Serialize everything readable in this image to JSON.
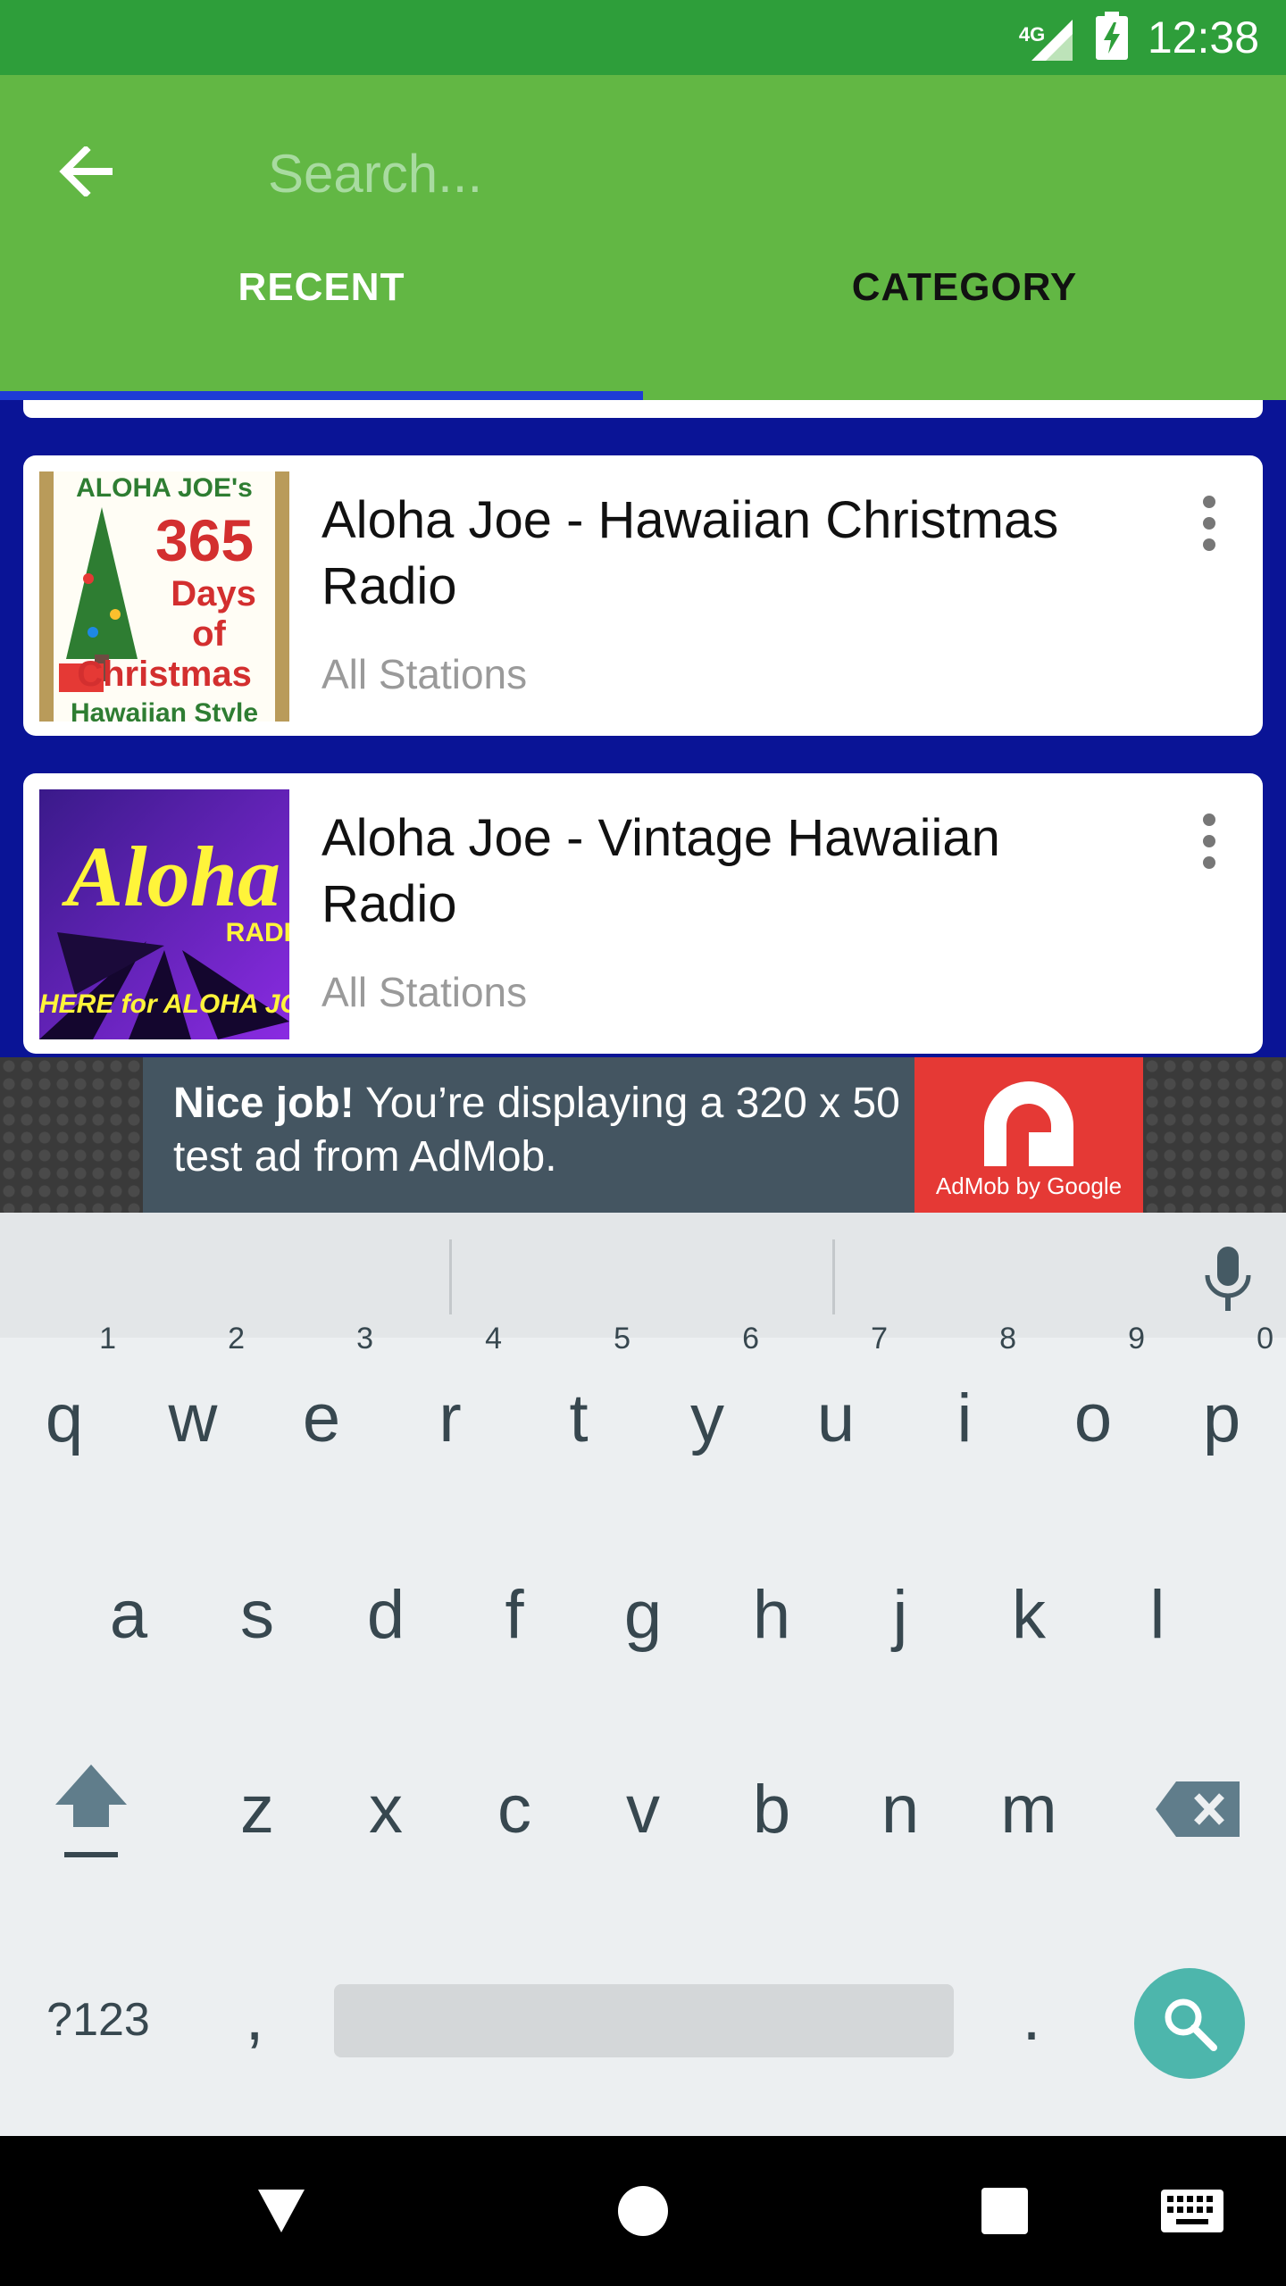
{
  "status_bar": {
    "network": "4G",
    "time": "12:38"
  },
  "toolbar": {
    "search_placeholder": "Search...",
    "tabs": [
      {
        "label": "RECENT",
        "active": true
      },
      {
        "label": "CATEGORY",
        "active": false
      }
    ]
  },
  "stations": [
    {
      "title": "Aloha Joe - Hawaiian Christmas Radio",
      "subtitle": "All Stations",
      "thumb_text": [
        "ALOHA JOE's",
        "365",
        "Days",
        "of",
        "Christmas",
        "Hawaiian Style"
      ]
    },
    {
      "title": "Aloha Joe - Vintage Hawaiian Radio",
      "subtitle": "All Stations",
      "thumb_text": [
        "Aloha",
        "RADI",
        "HERE for ALOHA JOE R"
      ]
    }
  ],
  "ad": {
    "bold": "Nice job!",
    "text": " You’re displaying a 320 x 50 test ad from AdMob.",
    "logo_text": "AdMob by Google"
  },
  "keyboard": {
    "row1": [
      {
        "key": "q",
        "hint": "1"
      },
      {
        "key": "w",
        "hint": "2"
      },
      {
        "key": "e",
        "hint": "3"
      },
      {
        "key": "r",
        "hint": "4"
      },
      {
        "key": "t",
        "hint": "5"
      },
      {
        "key": "y",
        "hint": "6"
      },
      {
        "key": "u",
        "hint": "7"
      },
      {
        "key": "i",
        "hint": "8"
      },
      {
        "key": "o",
        "hint": "9"
      },
      {
        "key": "p",
        "hint": "0"
      }
    ],
    "row2": [
      "a",
      "s",
      "d",
      "f",
      "g",
      "h",
      "j",
      "k",
      "l"
    ],
    "row3": [
      "z",
      "x",
      "c",
      "v",
      "b",
      "n",
      "m"
    ],
    "symbols_label": "?123",
    "comma": ",",
    "period": "."
  },
  "colors": {
    "status_bar": "#2e9e3a",
    "toolbar": "#62b744",
    "tab_indicator": "#1e3bd6",
    "list_background": "#0a1496",
    "search_key": "#4db6ac",
    "ad_logo": "#e53935"
  }
}
